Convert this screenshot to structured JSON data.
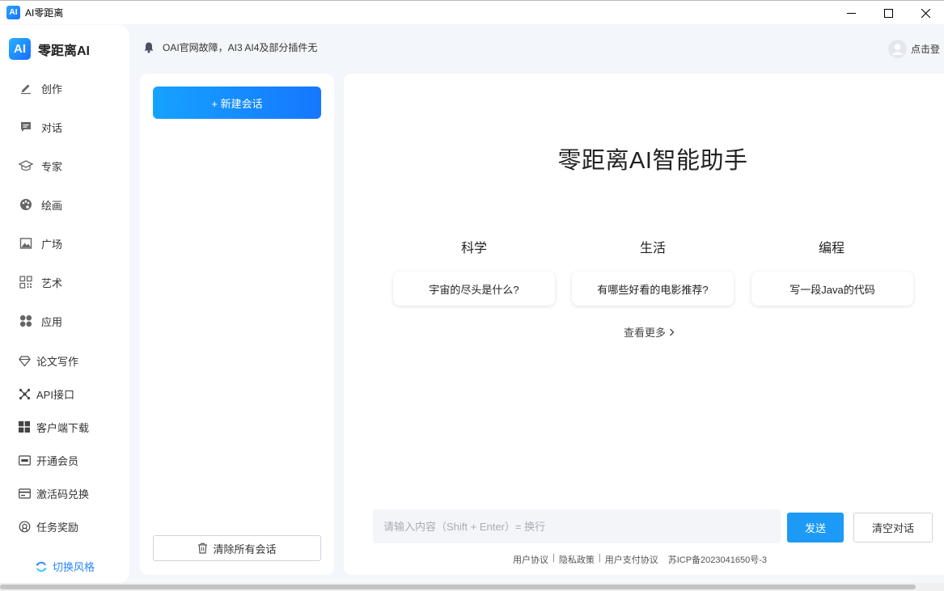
{
  "window": {
    "title": "AI零距离",
    "logo_text": "AI",
    "controls": [
      "minimize-icon",
      "maximize-icon",
      "close-icon"
    ]
  },
  "brand": {
    "logo_text": "AI",
    "name": "零距离AI"
  },
  "sidebar": {
    "items": [
      {
        "label": "创作",
        "icon": "pencil-icon"
      },
      {
        "label": "对话",
        "icon": "chat-bubble-icon"
      },
      {
        "label": "专家",
        "icon": "graduation-cap-icon"
      },
      {
        "label": "绘画",
        "icon": "palette-icon"
      },
      {
        "label": "广场",
        "icon": "image-icon"
      },
      {
        "label": "艺术",
        "icon": "qr-grid-icon"
      },
      {
        "label": "应用",
        "icon": "apps-icon"
      }
    ],
    "secondary_items": [
      {
        "label": "论文写作",
        "icon": "diamond-icon"
      },
      {
        "label": "API接口",
        "icon": "api-hub-icon"
      },
      {
        "label": "客户端下载",
        "icon": "windows-icon"
      },
      {
        "label": "开通会员",
        "icon": "vip-card-icon"
      },
      {
        "label": "激活码兑换",
        "icon": "gift-card-icon"
      },
      {
        "label": "任务奖励",
        "icon": "reward-icon"
      }
    ],
    "switch_style_label": "切换风格"
  },
  "header": {
    "notice": "OAI官网故障，AI3 AI4及部分插件无",
    "login_label": "点击登"
  },
  "conversations": {
    "new_chat_label": "+ 新建会话",
    "clear_all_label": "清除所有会话"
  },
  "main": {
    "title": "零距离AI智能助手",
    "categories": [
      {
        "name": "科学",
        "prompt": "宇宙的尽头是什么?"
      },
      {
        "name": "生活",
        "prompt": "有哪些好看的电影推荐?"
      },
      {
        "name": "编程",
        "prompt": "写一段Java的代码"
      }
    ],
    "see_more_label": "查看更多",
    "input_placeholder": "请输入内容（Shift + Enter）= 换行",
    "input_value": "",
    "send_label": "发送",
    "clear_chat_label": "清空对话"
  },
  "footer": {
    "links": [
      "用户协议",
      "隐私政策",
      "用户支付协议"
    ],
    "separator": "|",
    "icp": "苏ICP备2023041650号-3"
  },
  "colors": {
    "accent": "#1677ff",
    "send_button": "#1c9af5",
    "switch_style": "#2a86ff",
    "background": "#f3f6fb"
  }
}
